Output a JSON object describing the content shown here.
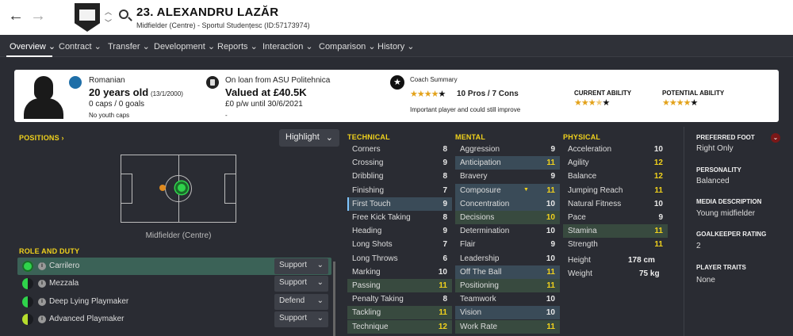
{
  "header": {
    "player_title": "23. ALEXANDRU LAZĂR",
    "player_subtitle": "Midfielder (Centre) - Sportul Studențesc (ID:57173974)"
  },
  "tabs": [
    {
      "label": "Overview"
    },
    {
      "label": "Contract"
    },
    {
      "label": "Transfer"
    },
    {
      "label": "Development"
    },
    {
      "label": "Reports"
    },
    {
      "label": "Interaction"
    },
    {
      "label": "Comparison"
    },
    {
      "label": "History"
    }
  ],
  "summary": {
    "nationality": "Romanian",
    "age": "20 years old",
    "dob": "(13/1/2000)",
    "caps_goals": "0 caps / 0 goals",
    "youth_caps": "No youth caps",
    "loan": "On loan from ASU Politehnica",
    "value": "Valued at £40.5K",
    "wage": "£0 p/w until 30/6/2021",
    "dash": "-",
    "coach_label": "Coach Summary",
    "coach_stars": 4,
    "coach_pros_cons": "10 Pros / 7 Cons",
    "coach_note": "Important player and could still improve",
    "current_ability_label": "CURRENT ABILITY",
    "current_ability_stars": 3.5,
    "potential_ability_label": "POTENTIAL ABILITY",
    "potential_ability_stars": 4.5
  },
  "positions": {
    "title": "POSITIONS",
    "highlight_button": "Highlight",
    "label": "Midfielder (Centre)"
  },
  "roles": {
    "title": "ROLE AND DUTY",
    "items": [
      {
        "name": "Carrilero",
        "duty": "Support"
      },
      {
        "name": "Mezzala",
        "duty": "Support"
      },
      {
        "name": "Deep Lying Playmaker",
        "duty": "Defend"
      },
      {
        "name": "Advanced Playmaker",
        "duty": "Support"
      }
    ]
  },
  "technical": {
    "title": "TECHNICAL",
    "rows": [
      {
        "name": "Corners",
        "value": "8"
      },
      {
        "name": "Crossing",
        "value": "9"
      },
      {
        "name": "Dribbling",
        "value": "8"
      },
      {
        "name": "Finishing",
        "value": "7"
      },
      {
        "name": "First Touch",
        "value": "9"
      },
      {
        "name": "Free Kick Taking",
        "value": "8"
      },
      {
        "name": "Heading",
        "value": "9"
      },
      {
        "name": "Long Shots",
        "value": "7"
      },
      {
        "name": "Long Throws",
        "value": "6"
      },
      {
        "name": "Marking",
        "value": "10"
      },
      {
        "name": "Passing",
        "value": "11"
      },
      {
        "name": "Penalty Taking",
        "value": "8"
      },
      {
        "name": "Tackling",
        "value": "11"
      },
      {
        "name": "Technique",
        "value": "12"
      }
    ]
  },
  "mental": {
    "title": "MENTAL",
    "rows": [
      {
        "name": "Aggression",
        "value": "9"
      },
      {
        "name": "Anticipation",
        "value": "11"
      },
      {
        "name": "Bravery",
        "value": "9"
      },
      {
        "name": "Composure",
        "value": "11"
      },
      {
        "name": "Concentration",
        "value": "10"
      },
      {
        "name": "Decisions",
        "value": "10"
      },
      {
        "name": "Determination",
        "value": "10"
      },
      {
        "name": "Flair",
        "value": "9"
      },
      {
        "name": "Leadership",
        "value": "10"
      },
      {
        "name": "Off The Ball",
        "value": "11"
      },
      {
        "name": "Positioning",
        "value": "11"
      },
      {
        "name": "Teamwork",
        "value": "10"
      },
      {
        "name": "Vision",
        "value": "10"
      },
      {
        "name": "Work Rate",
        "value": "11"
      }
    ]
  },
  "physical": {
    "title": "PHYSICAL",
    "rows": [
      {
        "name": "Acceleration",
        "value": "10"
      },
      {
        "name": "Agility",
        "value": "12"
      },
      {
        "name": "Balance",
        "value": "12"
      },
      {
        "name": "Jumping Reach",
        "value": "11"
      },
      {
        "name": "Natural Fitness",
        "value": "10"
      },
      {
        "name": "Pace",
        "value": "9"
      },
      {
        "name": "Stamina",
        "value": "11"
      },
      {
        "name": "Strength",
        "value": "11"
      }
    ],
    "height_label": "Height",
    "height_value": "178 cm",
    "weight_label": "Weight",
    "weight_value": "75 kg"
  },
  "info": {
    "preferred_foot_label": "PREFERRED FOOT",
    "preferred_foot": "Right Only",
    "personality_label": "PERSONALITY",
    "personality": "Balanced",
    "media_label": "MEDIA DESCRIPTION",
    "media": "Young midfielder",
    "gk_label": "GOALKEEPER RATING",
    "gk": "2",
    "traits_label": "PLAYER TRAITS",
    "traits": "None"
  }
}
